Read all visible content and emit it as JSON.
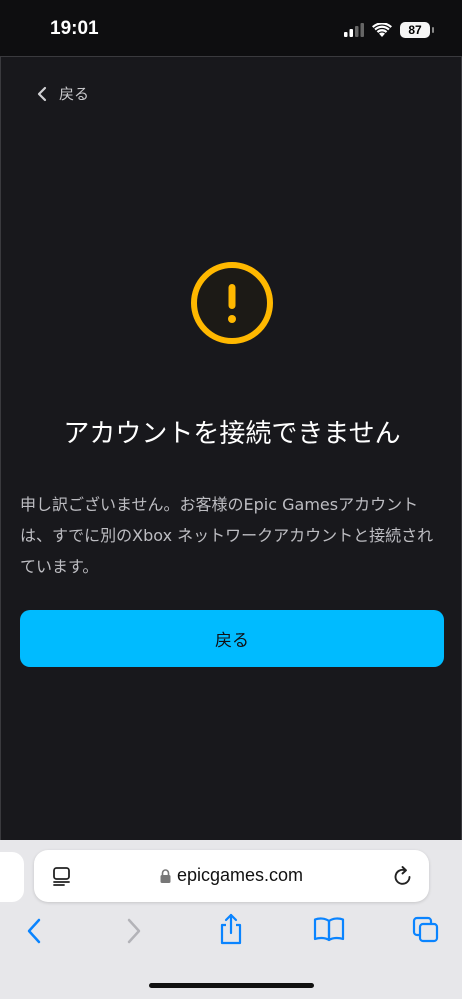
{
  "status_bar": {
    "time": "19:01",
    "battery": "87"
  },
  "nav": {
    "back_label": "戻る"
  },
  "error": {
    "title": "アカウントを接続できません",
    "message": "申し訳ございません。お客様のEpic Gamesアカウントは、すでに別のXbox ネットワークアカウントと接続されています。"
  },
  "actions": {
    "back_button": "戻る"
  },
  "browser": {
    "url": "epicgames.com"
  },
  "colors": {
    "accent": "#00BBFF",
    "warning": "#FFB800",
    "background": "#18181C"
  },
  "icons": [
    "chevron-left-icon",
    "warning-icon",
    "reader-icon",
    "lock-icon",
    "reload-icon",
    "back-arrow-icon",
    "forward-arrow-icon",
    "share-icon",
    "bookmarks-icon",
    "tabs-icon"
  ]
}
